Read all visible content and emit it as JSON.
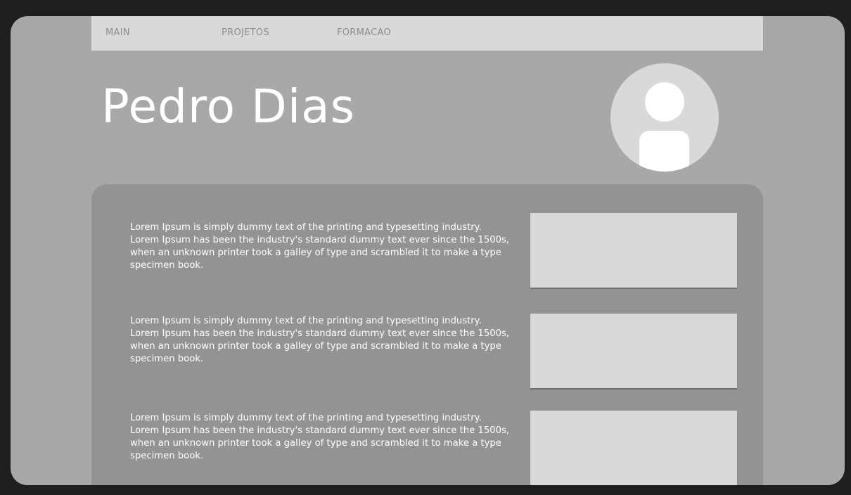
{
  "nav": {
    "items": [
      {
        "label": "MAIN"
      },
      {
        "label": "PROJETOS"
      },
      {
        "label": "FORMACAO"
      }
    ]
  },
  "header": {
    "title": "Pedro Dias",
    "avatar_icon": "user-avatar-icon"
  },
  "content": {
    "rows": [
      {
        "text": "Lorem Ipsum is simply dummy text of the printing and typesetting industry. Lorem Ipsum has been the industry's standard dummy text ever since the 1500s, when an unknown printer took a galley of type and scrambled it to make a type specimen book."
      },
      {
        "text": "Lorem Ipsum is simply dummy text of the printing and typesetting industry. Lorem Ipsum has been the industry's standard dummy text ever since the 1500s, when an unknown printer took a galley of type and scrambled it to make a type specimen book."
      },
      {
        "text": "Lorem Ipsum is simply dummy text of the printing and typesetting industry. Lorem Ipsum has been the industry's standard dummy text ever since the 1500s, when an unknown printer took a galley of type and scrambled it to make a type specimen book."
      }
    ]
  },
  "colors": {
    "background": "#1e1e1e",
    "frame": "#a8a8a8",
    "navbar": "#d9d9d9",
    "panel": "#939393",
    "placeholder": "#d9d9d9"
  }
}
